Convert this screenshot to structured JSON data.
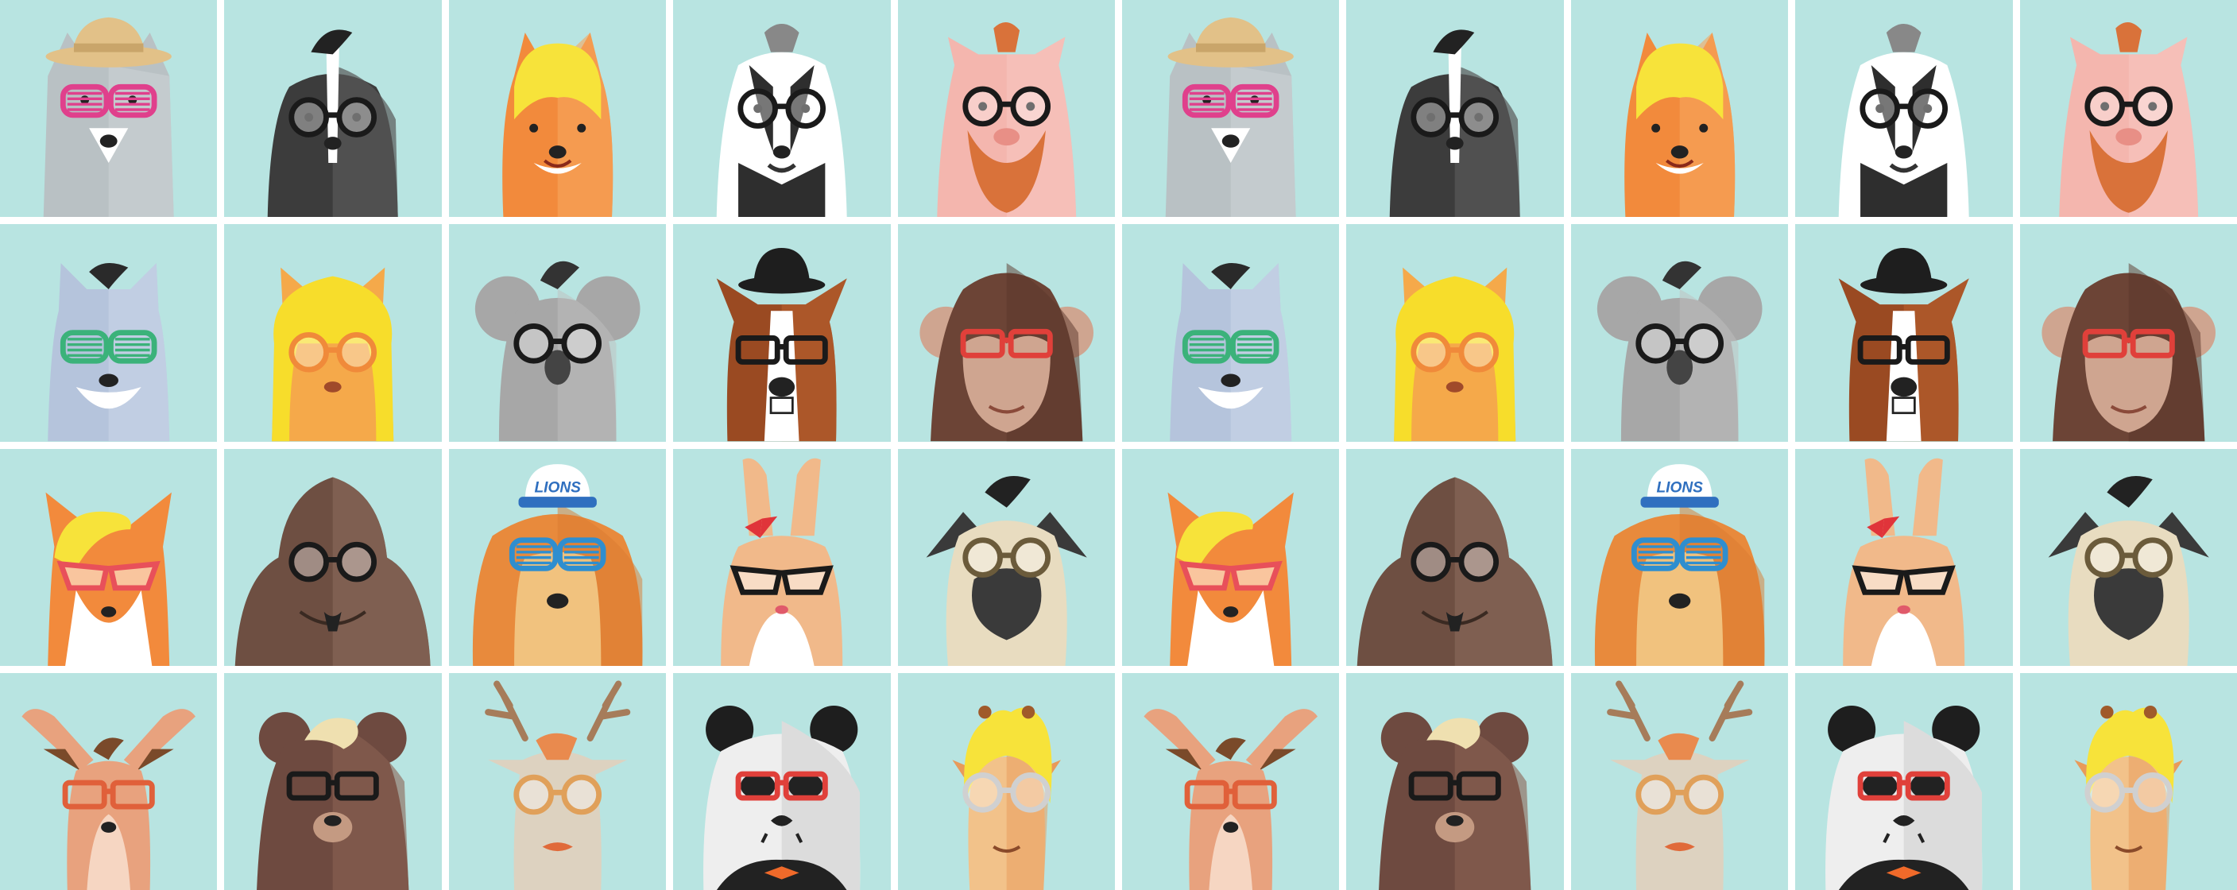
{
  "background": "#b8e4e1",
  "gap_color": "#ffffff",
  "grid": {
    "columns": 10,
    "rows": 4
  },
  "row_patterns": [
    [
      "wolf-hat-icon",
      "skunk-icon",
      "squirrel-icon",
      "badger-icon",
      "pig-icon"
    ],
    [
      "raccoon-icon",
      "cat-icon",
      "koala-icon",
      "dog-bowler-icon",
      "monkey-icon"
    ],
    [
      "fox-icon",
      "gorilla-icon",
      "lion-icon",
      "rabbit-icon",
      "pug-icon"
    ],
    [
      "kangaroo-icon",
      "bear-icon",
      "deer-icon",
      "panda-icon",
      "giraffe-icon"
    ]
  ],
  "animals": {
    "wolf-hat-icon": {
      "fur": "#b9c1c4",
      "fur2": "#cfd6d8",
      "glasses": "#e0408c",
      "glasses_style": "shutter",
      "hat": "#e2c188"
    },
    "skunk-icon": {
      "fur": "#3c3c3c",
      "fur2": "#585858",
      "glasses": "#1a1a1a",
      "glasses_style": "round"
    },
    "squirrel-icon": {
      "fur": "#f28a3c",
      "fur2": "#f6a65d",
      "hair": "#f7e33a"
    },
    "badger-icon": {
      "fur": "#2e2e2e",
      "fur2": "#ffffff",
      "glasses": "#1a1a1a",
      "glasses_style": "round"
    },
    "pig-icon": {
      "fur": "#f4b6ae",
      "fur2": "#f7c8c2",
      "beard": "#d9723a",
      "glasses": "#1a1a1a",
      "glasses_style": "round"
    },
    "raccoon-icon": {
      "fur": "#b5c4dc",
      "fur2": "#c9d5e8",
      "glasses": "#3bb27a",
      "glasses_style": "shutter"
    },
    "cat-icon": {
      "fur": "#f5a94a",
      "fur2": "#f8bf6a",
      "hair": "#f7dd2b",
      "glasses": "#f08a3a",
      "glasses_style": "round"
    },
    "koala-icon": {
      "fur": "#a7a7a7",
      "fur2": "#c0c0c0",
      "glasses": "#1a1a1a",
      "glasses_style": "round"
    },
    "dog-bowler-icon": {
      "fur": "#9a4a22",
      "fur2": "#b9602e",
      "glasses": "#1a1a1a",
      "glasses_style": "rect",
      "hat": "#1e1e1e"
    },
    "monkey-icon": {
      "fur": "#6c4436",
      "fur2": "#cfa590",
      "glasses": "#e0403a",
      "glasses_style": "rect"
    },
    "fox-icon": {
      "fur": "#f28a3c",
      "fur2": "#ffffff",
      "hair": "#f7e33a",
      "glasses": "#e8505a",
      "glasses_style": "cat"
    },
    "gorilla-icon": {
      "fur": "#6e4f42",
      "fur2": "#8a6a5b",
      "glasses": "#1a1a1a",
      "glasses_style": "round"
    },
    "lion-icon": {
      "fur": "#e88a3c",
      "fur2": "#f1c27e",
      "glasses": "#2f8ecf",
      "glasses_style": "shutter",
      "hat": "#ffffff",
      "cap_text": "LIONS"
    },
    "rabbit-icon": {
      "fur": "#f1b98a",
      "fur2": "#ffffff",
      "bow": "#e0343a",
      "glasses": "#1a1a1a",
      "glasses_style": "cat"
    },
    "pug-icon": {
      "fur": "#e8dcc0",
      "fur2": "#3a3a3a",
      "glasses": "#6b5b3b",
      "glasses_style": "round"
    },
    "kangaroo-icon": {
      "fur": "#e8a27e",
      "fur2": "#f6d6c2",
      "glasses": "#e0603a",
      "glasses_style": "rect"
    },
    "bear-icon": {
      "fur": "#6e4a40",
      "fur2": "#8a6254",
      "hair": "#efe0b0",
      "glasses": "#1a1a1a",
      "glasses_style": "rect"
    },
    "deer-icon": {
      "fur": "#ddd2c0",
      "fur2": "#e98a4e",
      "antlers": "#a67c5a",
      "glasses": "#e0a05a",
      "glasses_style": "round"
    },
    "panda-icon": {
      "fur": "#eeeeee",
      "fur2": "#1e1e1e",
      "glasses": "#e0403a",
      "glasses_style": "rect",
      "bow": "#f06a2a"
    },
    "giraffe-icon": {
      "fur": "#f2c28a",
      "fur2": "#e89a5a",
      "hair": "#f7e33a",
      "glasses": "#d0d0d0",
      "glasses_style": "round"
    }
  }
}
